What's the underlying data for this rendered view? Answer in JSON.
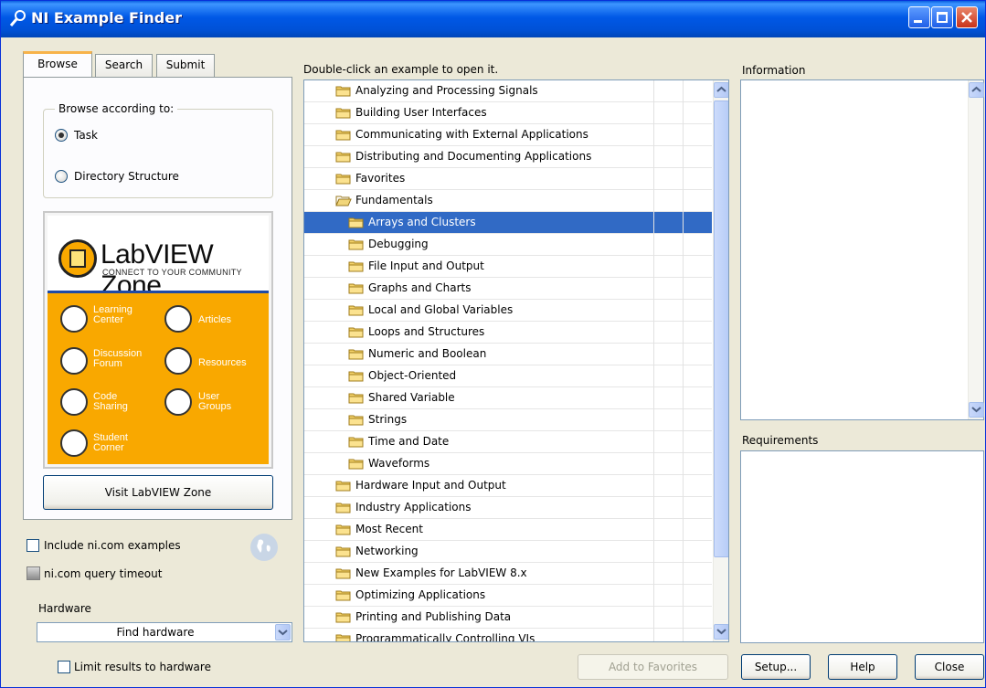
{
  "window": {
    "title": "NI Example Finder"
  },
  "tabs": [
    {
      "label": "Browse"
    },
    {
      "label": "Search"
    },
    {
      "label": "Submit"
    }
  ],
  "browse": {
    "group_title": "Browse according to:",
    "options": [
      {
        "label": "Task",
        "checked": true
      },
      {
        "label": "Directory Structure",
        "checked": false
      }
    ]
  },
  "zone": {
    "title": "LabVIEW Zone",
    "subtitle": "CONNECT TO YOUR COMMUNITY",
    "items": [
      {
        "label": "Learning Center",
        "icon": "graduation-cap-icon"
      },
      {
        "label": "Articles",
        "icon": "document-icon"
      },
      {
        "label": "Discussion Forum",
        "icon": "chat-icon"
      },
      {
        "label": "Resources",
        "icon": "book-icon"
      },
      {
        "label": "Code Sharing",
        "icon": "gears-icon"
      },
      {
        "label": "User Groups",
        "icon": "people-icon"
      },
      {
        "label": "Student Corner",
        "icon": "student-icon"
      }
    ],
    "button": "Visit LabVIEW Zone"
  },
  "options": {
    "include_ni": "Include ni.com examples",
    "query_timeout": "ni.com query timeout",
    "hardware_label": "Hardware",
    "hardware_value": "Find hardware",
    "limit": "Limit results to hardware"
  },
  "tree": {
    "instruction": "Double-click an example to open it.",
    "items": [
      {
        "label": "Analyzing and Processing Signals",
        "level": 0
      },
      {
        "label": "Building User Interfaces",
        "level": 0
      },
      {
        "label": "Communicating with External Applications",
        "level": 0
      },
      {
        "label": "Distributing and Documenting Applications",
        "level": 0
      },
      {
        "label": "Favorites",
        "level": 0
      },
      {
        "label": "Fundamentals",
        "level": 0,
        "open": true
      },
      {
        "label": "Arrays and Clusters",
        "level": 1,
        "selected": true
      },
      {
        "label": "Debugging",
        "level": 1
      },
      {
        "label": "File Input and Output",
        "level": 1
      },
      {
        "label": "Graphs and Charts",
        "level": 1
      },
      {
        "label": "Local and Global Variables",
        "level": 1
      },
      {
        "label": "Loops and Structures",
        "level": 1
      },
      {
        "label": "Numeric and Boolean",
        "level": 1
      },
      {
        "label": "Object-Oriented",
        "level": 1
      },
      {
        "label": "Shared Variable",
        "level": 1
      },
      {
        "label": "Strings",
        "level": 1
      },
      {
        "label": "Time and Date",
        "level": 1
      },
      {
        "label": "Waveforms",
        "level": 1
      },
      {
        "label": "Hardware Input and Output",
        "level": 0
      },
      {
        "label": "Industry Applications",
        "level": 0
      },
      {
        "label": "Most Recent",
        "level": 0
      },
      {
        "label": "Networking",
        "level": 0
      },
      {
        "label": "New Examples for LabVIEW 8.x",
        "level": 0
      },
      {
        "label": "Optimizing Applications",
        "level": 0
      },
      {
        "label": "Printing and Publishing Data",
        "level": 0
      },
      {
        "label": "Programmatically Controlling VIs",
        "level": 0
      }
    ]
  },
  "info": {
    "information_label": "Information",
    "requirements_label": "Requirements"
  },
  "buttons": {
    "add_favorites": "Add to Favorites",
    "setup": "Setup...",
    "help": "Help",
    "close": "Close"
  },
  "colors": {
    "selection": "#316ac5",
    "titlebar": "#0058e6",
    "zone_orange": "#f9a800"
  }
}
